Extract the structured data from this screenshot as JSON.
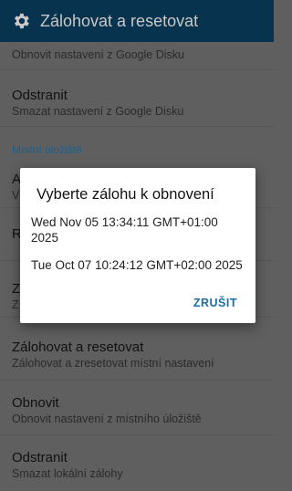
{
  "appbar": {
    "title": "Zálohovat a resetovat",
    "icon": "gear-icon"
  },
  "list": {
    "item_google_restore": {
      "subtitle": "Obnovit nastavení z Google Disku"
    },
    "item_google_delete": {
      "title": "Odstranit",
      "subtitle": "Smazat nastavení z Google Disku"
    },
    "section_local": "Místní úložiště",
    "hidden_items": [
      {
        "title_fragment": "A",
        "subtitle_fragment": "V"
      },
      {
        "title_fragment": "R",
        "subtitle_fragment": ""
      },
      {
        "title_fragment": "Z",
        "subtitle_fragment": "Z"
      }
    ],
    "item_backup_reset": {
      "title": "Zálohovat a resetovat",
      "subtitle": "Zálohovat a zresetovat místní nastavení"
    },
    "item_restore": {
      "title": "Obnovit",
      "subtitle": "Obnovit nastavení z místního úložiště"
    },
    "item_delete": {
      "title": "Odstranit",
      "subtitle": "Smazat lokální zálohy"
    }
  },
  "dialog": {
    "title": "Vyberte zálohu k obnovení",
    "options": [
      "Wed Nov 05 13:34:11 GMT+01:00 2025",
      "Tue Oct 07 10:24:12 GMT+02:00 2025"
    ],
    "cancel_label": "ZRUŠIT"
  },
  "colors": {
    "appbar": "#08334f",
    "accent": "#1b6fa8",
    "scrim": "#5f5f5f"
  }
}
